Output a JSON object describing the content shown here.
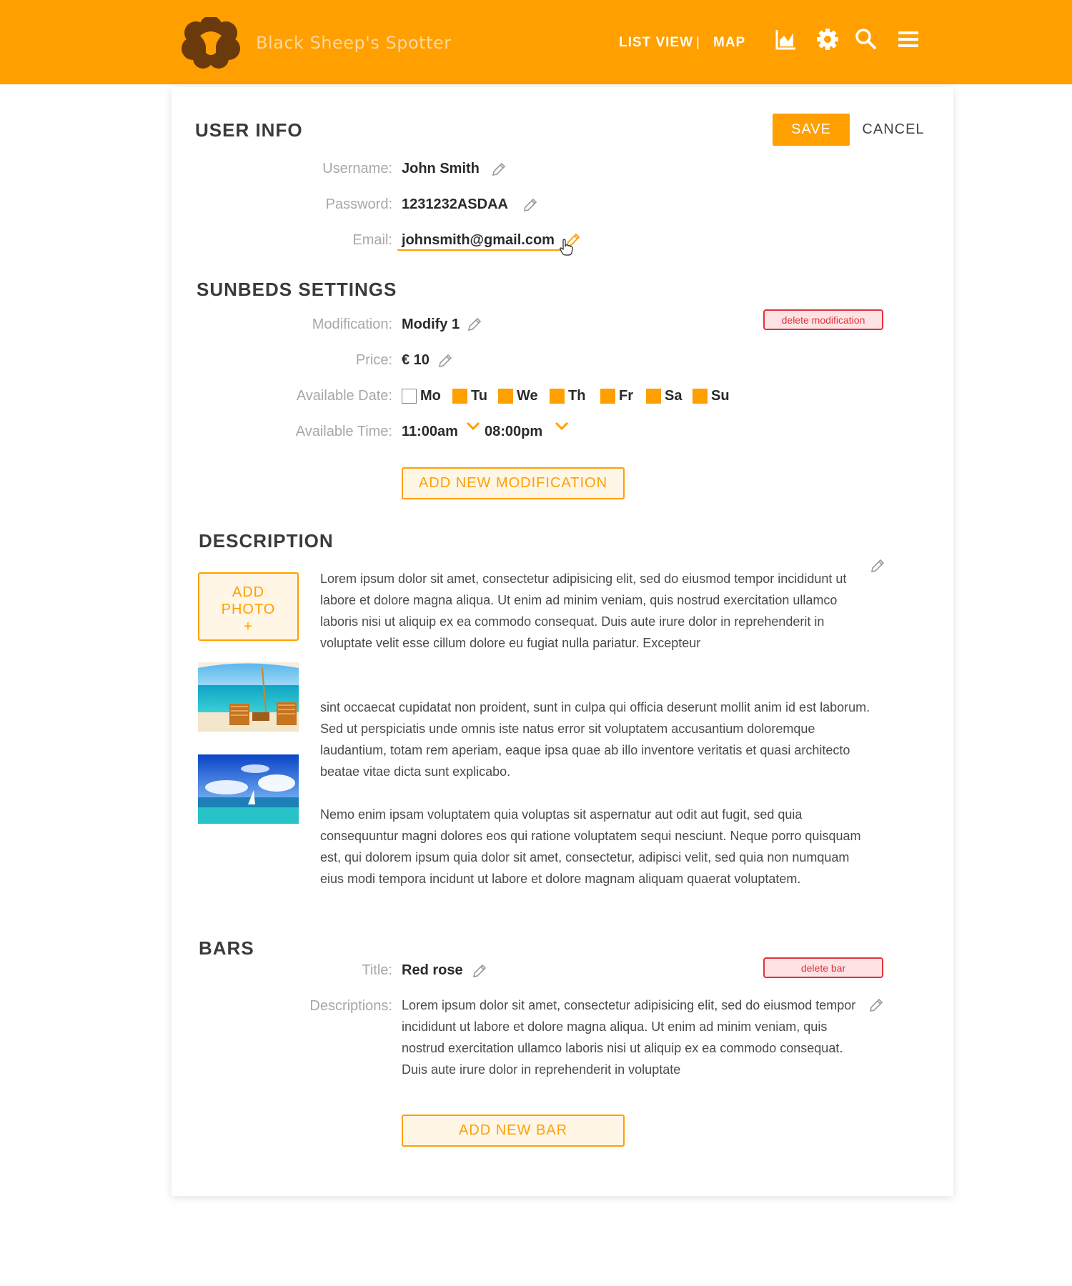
{
  "header": {
    "brand": "Black Sheep's Spotter",
    "nav_list_view": "LIST VIEW",
    "nav_separator": "|",
    "nav_map": "MAP",
    "icons": [
      "chart-icon",
      "gear-icon",
      "search-icon",
      "menu-icon"
    ],
    "accent_color": "#ff9f00"
  },
  "user_info": {
    "title": "USER INFO",
    "save_label": "SAVE",
    "cancel_label": "CANCEL",
    "username_label": "Username:",
    "username_value": "John Smith",
    "password_label": "Password:",
    "password_value": "1231232ASDAA",
    "email_label": "Email:",
    "email_value": "johnsmith@gmail.com"
  },
  "sunbeds": {
    "title": "SUNBEDS SETTINGS",
    "modification_label": "Modification:",
    "modification_value": "Modify 1",
    "delete_label": "delete modification",
    "price_label": "Price:",
    "price_value": "€ 10",
    "date_label": "Available Date:",
    "days": [
      {
        "label": "Mo",
        "checked": false
      },
      {
        "label": "Tu",
        "checked": true
      },
      {
        "label": "We",
        "checked": true
      },
      {
        "label": "Th",
        "checked": true
      },
      {
        "label": "Fr",
        "checked": true
      },
      {
        "label": "Sa",
        "checked": true
      },
      {
        "label": "Su",
        "checked": true
      }
    ],
    "time_label": "Available Time:",
    "time_from": "11:00am",
    "time_to": "08:00pm",
    "add_label": "ADD NEW MODIFICATION"
  },
  "description": {
    "title": "DESCRIPTION",
    "add_photo_label": "ADD\nPHOTO\n+",
    "paragraphs": [
      "Lorem ipsum dolor sit amet, consectetur adipisicing elit, sed do eiusmod tempor incididunt ut labore et dolore magna aliqua. Ut enim ad minim veniam, quis nostrud exercitation ullamco laboris nisi ut aliquip ex ea commodo consequat. Duis aute irure dolor in reprehenderit in voluptate velit esse cillum dolore eu fugiat nulla pariatur. Excepteur",
      "sint occaecat cupidatat non proident, sunt in culpa qui officia deserunt mollit anim id est laborum. Sed ut perspiciatis unde omnis iste natus error sit voluptatem accusantium doloremque laudantium, totam rem aperiam, eaque ipsa quae ab illo inventore veritatis et quasi architecto beatae vitae dicta sunt explicabo.",
      "Nemo enim ipsam voluptatem quia voluptas sit aspernatur aut odit aut fugit, sed quia consequuntur magni dolores eos qui ratione voluptatem sequi nesciunt. Neque porro quisquam est, qui dolorem ipsum quia dolor sit amet, consectetur, adipisci velit, sed quia non numquam eius modi tempora incidunt ut labore et dolore magnam aliquam quaerat voluptatem."
    ]
  },
  "bars": {
    "title": "BARS",
    "title_label": "Title:",
    "title_value": "Red rose",
    "delete_label": "delete bar",
    "descriptions_label": "Descriptions:",
    "descriptions_value": "Lorem ipsum dolor sit amet, consectetur adipisicing elit, sed do eiusmod tempor incididunt ut labore et dolore magna aliqua. Ut enim ad minim veniam, quis nostrud exercitation ullamco laboris nisi ut aliquip ex ea commodo consequat. Duis aute irure dolor in reprehenderit in voluptate",
    "add_label": "ADD NEW BAR"
  }
}
